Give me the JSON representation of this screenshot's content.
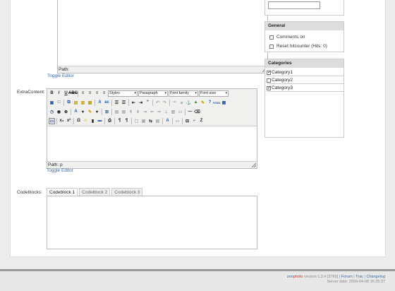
{
  "editor_top": {
    "path_label": "Path:",
    "toggle": "Toggle Editor"
  },
  "extra_content": {
    "label": "ExtraContent:",
    "toolbar": {
      "styles": "Styles",
      "paragraph": "Paragraph",
      "font_family": "Font family",
      "font_size": "Font size"
    },
    "path_label": "Path:",
    "path_value": "p",
    "toggle": "Toggle Editor"
  },
  "codeblocks": {
    "label": "Codeblocks:",
    "tabs": [
      "Codeblock 1",
      "Codeblock 2",
      "Codeblock 3"
    ]
  },
  "sidebar": {
    "general": {
      "title": "General",
      "items": [
        {
          "label": "Comments on",
          "checked": false
        },
        {
          "label": "Reset hitcounter (Hits: 0)",
          "checked": false
        }
      ]
    },
    "categories": {
      "title": "Categories",
      "items": [
        {
          "label": "Category1",
          "checked": true
        },
        {
          "label": "Category2",
          "checked": false
        },
        {
          "label": "Category3",
          "checked": true
        }
      ]
    }
  },
  "footer": {
    "brand_zen": "zen",
    "brand_photo": "photo",
    "version": "version 1.2.4 [3765]",
    "links": [
      "Forum",
      "Trac",
      "Changelog"
    ],
    "server_date": "Server date: 2009-04-08 16:25:37"
  }
}
